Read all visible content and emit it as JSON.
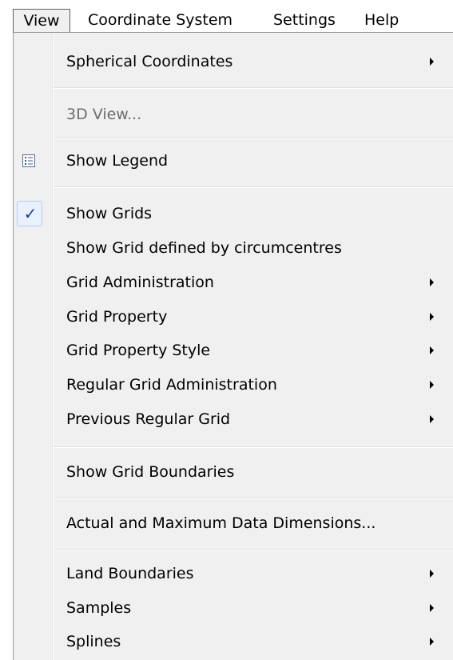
{
  "menubar": {
    "items": [
      {
        "label": "View"
      },
      {
        "label": "Coordinate System"
      },
      {
        "label": "Settings"
      },
      {
        "label": "Help"
      }
    ]
  },
  "view_menu": {
    "items": [
      {
        "label": "Spherical Coordinates",
        "submenu": true
      },
      {
        "label": "3D View...",
        "disabled": true
      },
      {
        "label": "Show Legend",
        "icon": "legend-list-icon"
      },
      {
        "label": "Show Grids",
        "checked": true,
        "icon": "checkmark-icon"
      },
      {
        "label": "Show Grid defined by circumcentres"
      },
      {
        "label": "Grid Administration",
        "submenu": true
      },
      {
        "label": "Grid Property",
        "submenu": true
      },
      {
        "label": "Grid Property Style",
        "submenu": true
      },
      {
        "label": "Regular Grid Administration",
        "submenu": true
      },
      {
        "label": "Previous Regular Grid",
        "submenu": true
      },
      {
        "label": "Show Grid Boundaries"
      },
      {
        "label": "Actual and Maximum Data Dimensions..."
      },
      {
        "label": "Land Boundaries",
        "submenu": true
      },
      {
        "label": "Samples",
        "submenu": true
      },
      {
        "label": "Splines",
        "submenu": true
      }
    ],
    "check_glyph": "✓"
  },
  "colors": {
    "menu_background": "#f0f0f0",
    "check_highlight": "#e8f1fc",
    "check_color": "#1c3fa6",
    "disabled_text": "#6d6d6d"
  }
}
